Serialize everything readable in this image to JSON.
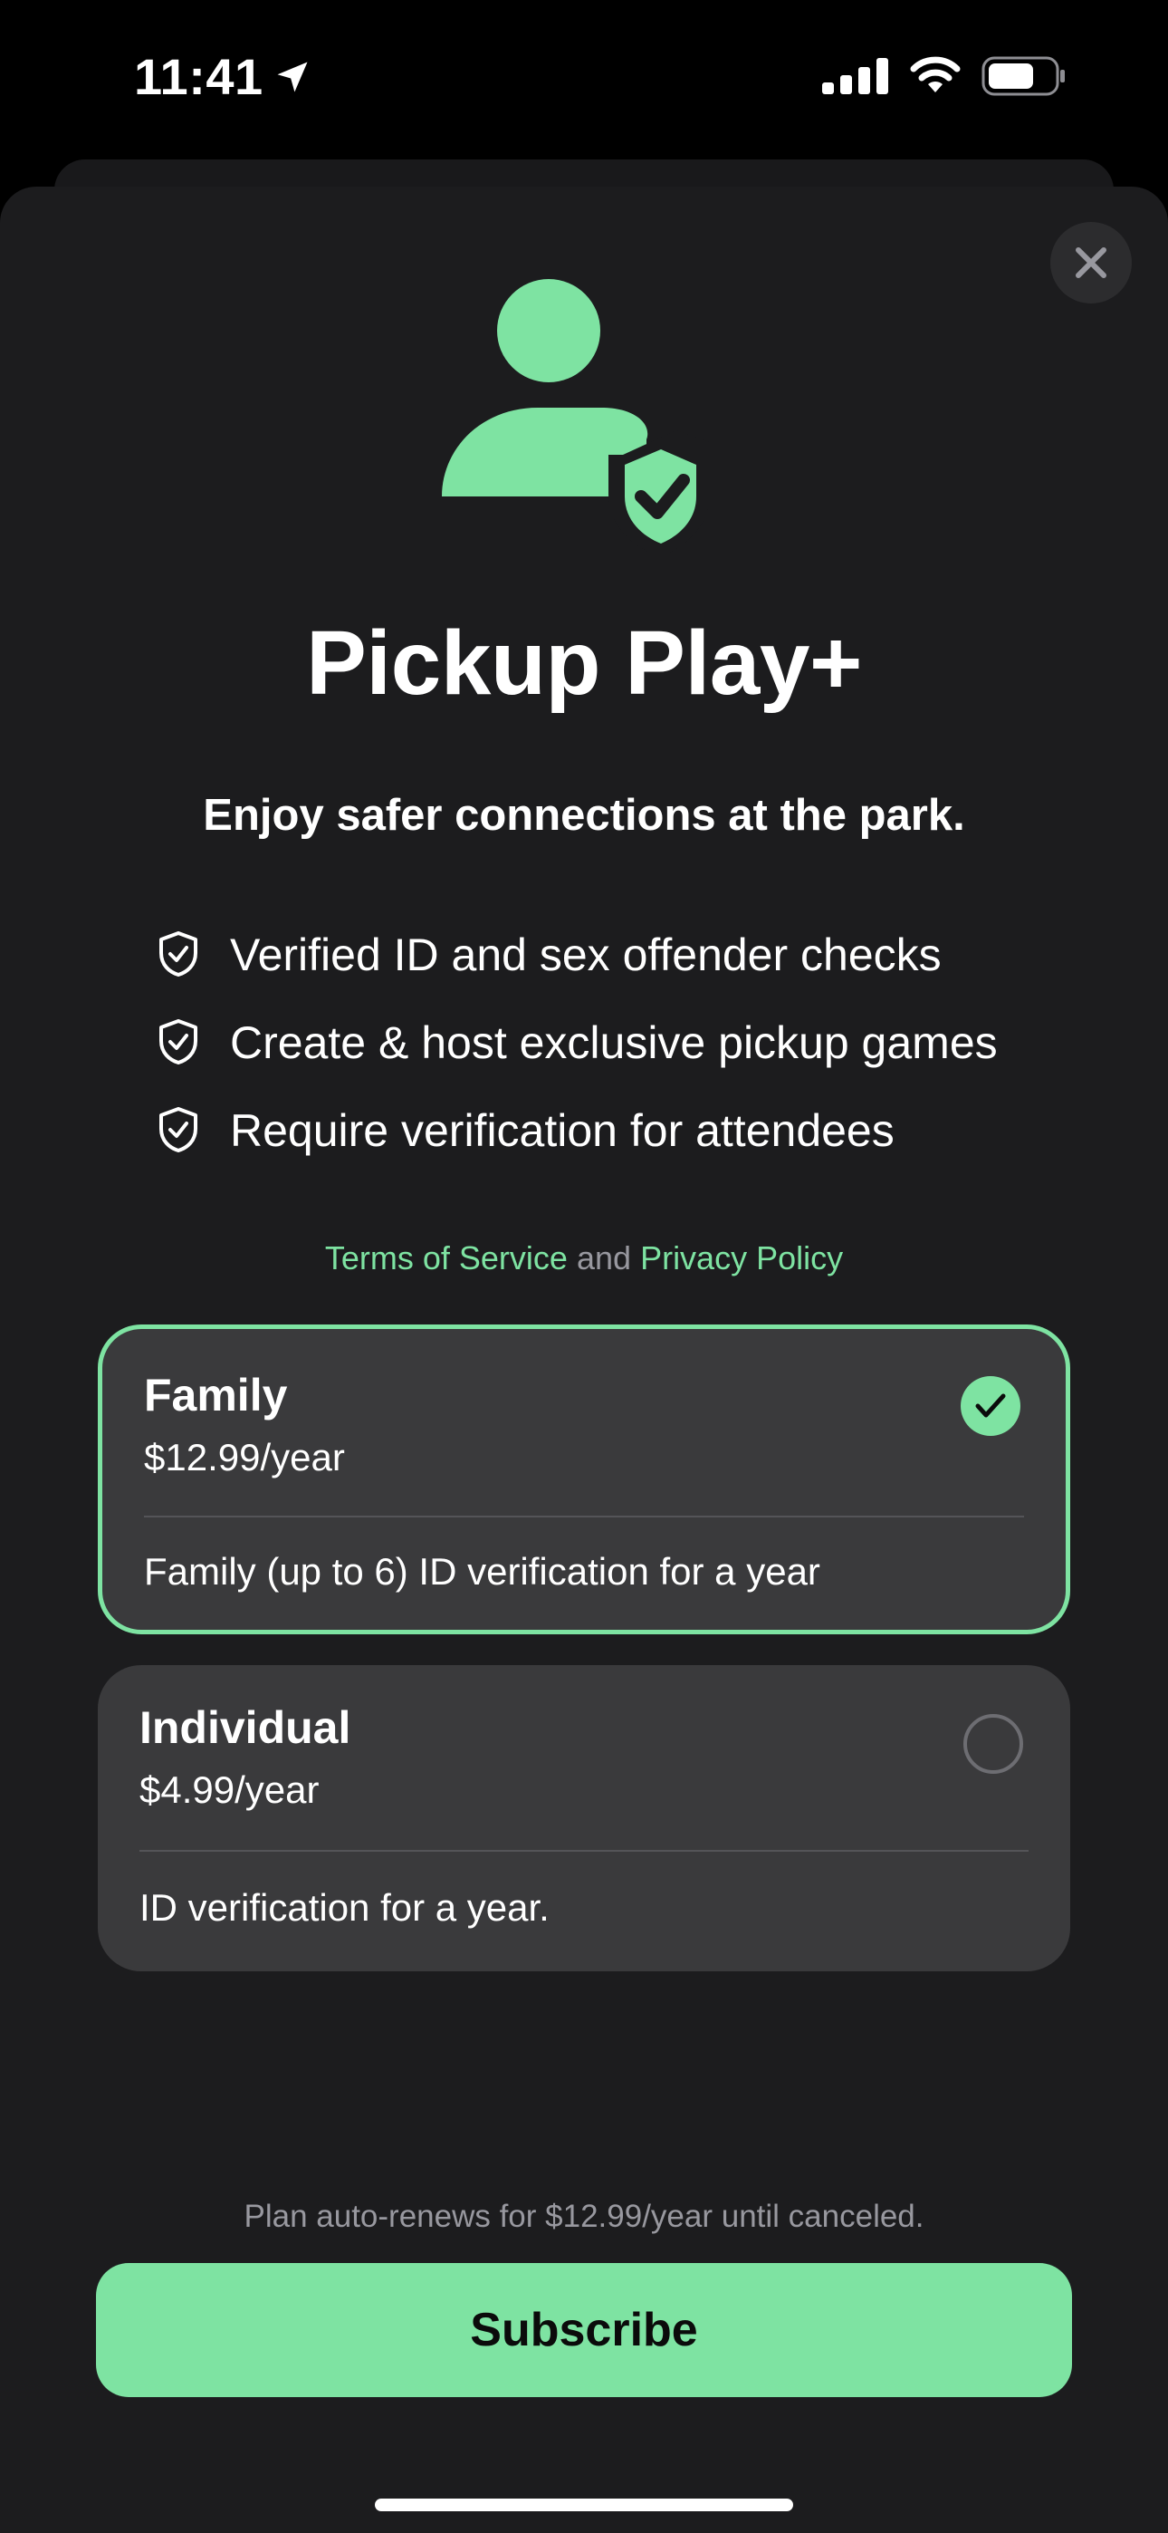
{
  "status_bar": {
    "time": "11:41",
    "battery_level": 0.7
  },
  "sheet": {
    "close_icon": "close-icon",
    "hero_icon": "person-shield-check-icon",
    "title": "Pickup Play+",
    "subtitle": "Enjoy safer connections at the park.",
    "features": [
      {
        "icon": "shield-check-icon",
        "label": "Verified ID and sex offender checks"
      },
      {
        "icon": "shield-check-icon",
        "label": "Create & host exclusive pickup games"
      },
      {
        "icon": "shield-check-icon",
        "label": "Require verification for attendees"
      }
    ],
    "legal": {
      "terms": "Terms of Service",
      "and": "and",
      "privacy": "Privacy Policy"
    },
    "plans": [
      {
        "name": "Family",
        "price": "$12.99/year",
        "description": "Family (up to 6) ID verification for a year",
        "selected": true
      },
      {
        "name": "Individual",
        "price": "$4.99/year",
        "description": "ID verification for a year.",
        "selected": false
      }
    ],
    "renew_note": "Plan auto-renews for $12.99/year until canceled.",
    "subscribe_label": "Subscribe"
  },
  "colors": {
    "accent": "#7ee3a2",
    "sheet_bg": "#1c1c1e",
    "card_bg": "#3a3a3c"
  }
}
